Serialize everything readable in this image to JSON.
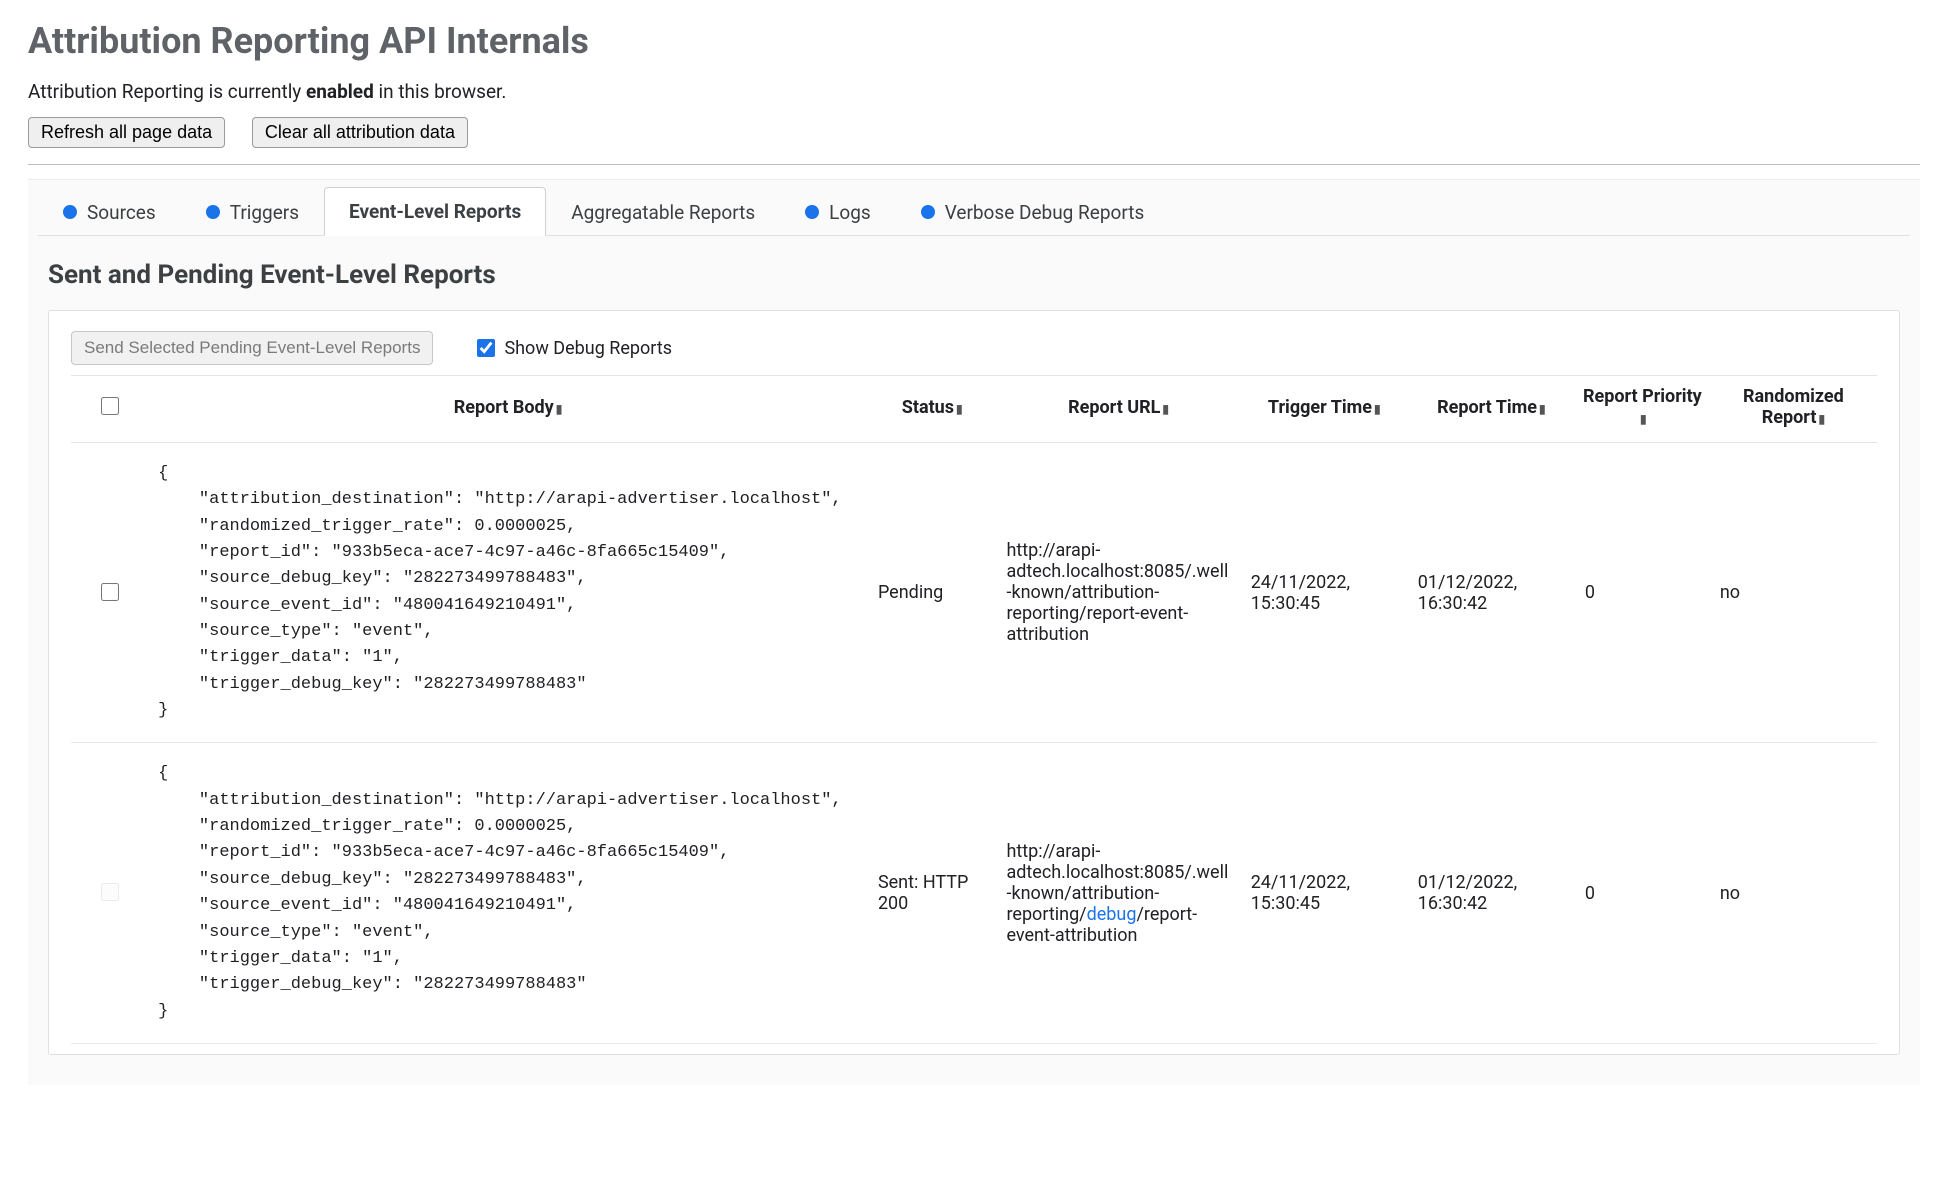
{
  "header": {
    "title": "Attribution Reporting API Internals",
    "status_prefix": "Attribution Reporting is currently ",
    "status_bold": "enabled",
    "status_suffix": " in this browser.",
    "refresh_button": "Refresh all page data",
    "clear_button": "Clear all attribution data"
  },
  "tabs": [
    {
      "label": "Sources",
      "dot": true,
      "active": false
    },
    {
      "label": "Triggers",
      "dot": true,
      "active": false
    },
    {
      "label": "Event-Level Reports",
      "dot": false,
      "active": true
    },
    {
      "label": "Aggregatable Reports",
      "dot": false,
      "active": false
    },
    {
      "label": "Logs",
      "dot": true,
      "active": false
    },
    {
      "label": "Verbose Debug Reports",
      "dot": true,
      "active": false
    }
  ],
  "section": {
    "title": "Sent and Pending Event-Level Reports",
    "send_button": "Send Selected Pending Event-Level Reports",
    "show_debug_label": "Show Debug Reports",
    "show_debug_checked": true
  },
  "table": {
    "columns": [
      "Report Body",
      "Status",
      "Report URL",
      "Trigger Time",
      "Report Time",
      "Report Priority",
      "Randomized Report"
    ],
    "rows": [
      {
        "selectable": true,
        "body": "{\n    \"attribution_destination\": \"http://arapi-advertiser.localhost\",\n    \"randomized_trigger_rate\": 0.0000025,\n    \"report_id\": \"933b5eca-ace7-4c97-a46c-8fa665c15409\",\n    \"source_debug_key\": \"282273499788483\",\n    \"source_event_id\": \"480041649210491\",\n    \"source_type\": \"event\",\n    \"trigger_data\": \"1\",\n    \"trigger_debug_key\": \"282273499788483\"\n}",
        "status": "Pending",
        "url_pre": "http://arapi-adtech.localhost:8085/.well-known/attribution-reporting/report-event-attribution",
        "url_debug_segment": "",
        "url_post": "",
        "trigger_time": "24/11/2022, 15:30:45",
        "report_time": "01/12/2022, 16:30:42",
        "priority": "0",
        "randomized": "no"
      },
      {
        "selectable": false,
        "body": "{\n    \"attribution_destination\": \"http://arapi-advertiser.localhost\",\n    \"randomized_trigger_rate\": 0.0000025,\n    \"report_id\": \"933b5eca-ace7-4c97-a46c-8fa665c15409\",\n    \"source_debug_key\": \"282273499788483\",\n    \"source_event_id\": \"480041649210491\",\n    \"source_type\": \"event\",\n    \"trigger_data\": \"1\",\n    \"trigger_debug_key\": \"282273499788483\"\n}",
        "status": "Sent: HTTP 200",
        "url_pre": "http://arapi-adtech.localhost:8085/.well-known/attribution-reporting/",
        "url_debug_segment": "debug",
        "url_post": "/report-event-attribution",
        "trigger_time": "24/11/2022, 15:30:45",
        "report_time": "01/12/2022, 16:30:42",
        "priority": "0",
        "randomized": "no"
      }
    ]
  }
}
